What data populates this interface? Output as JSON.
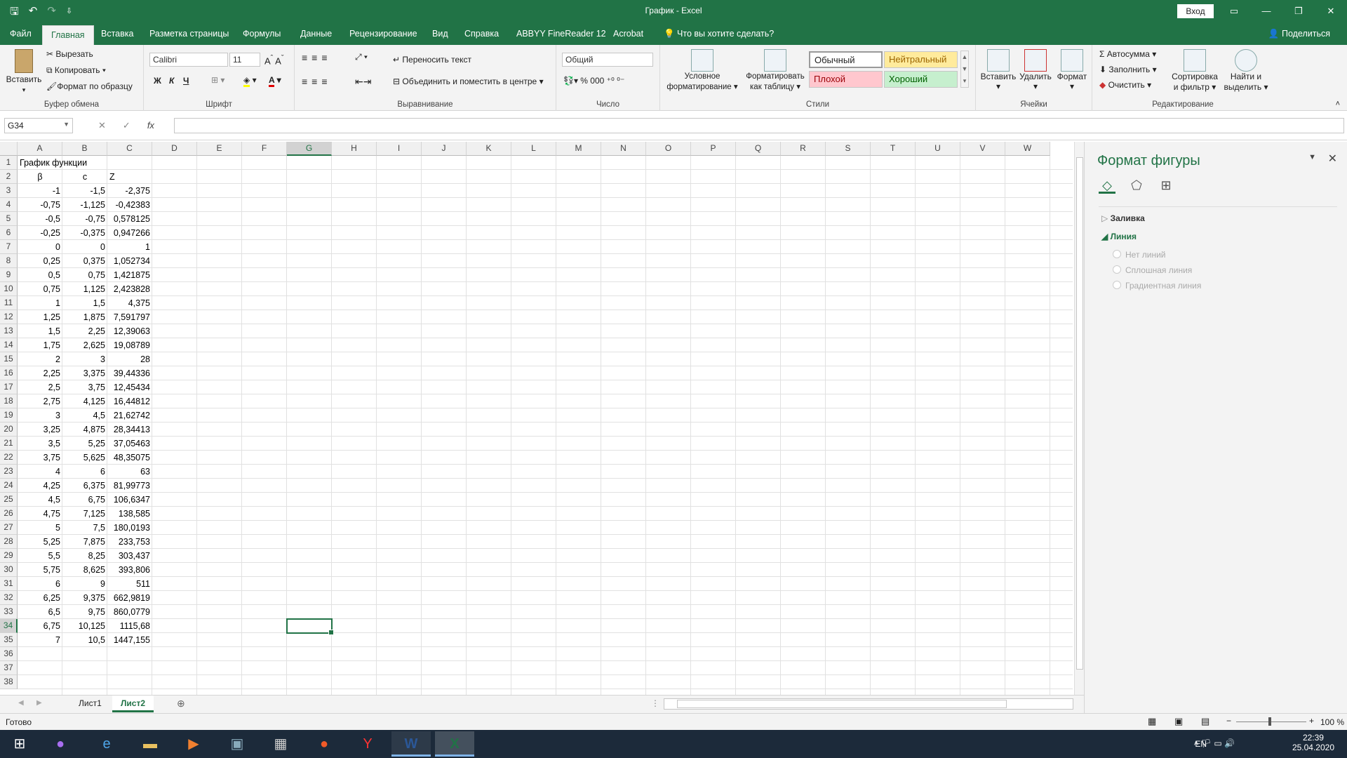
{
  "window": {
    "title": "График  -  Excel",
    "signin": "Вход"
  },
  "qat": {
    "save": "🖫",
    "undo": "↶",
    "redo": "↷",
    "more": "⇩"
  },
  "tabs": [
    "Файл",
    "Главная",
    "Вставка",
    "Разметка страницы",
    "Формулы",
    "Данные",
    "Рецензирование",
    "Вид",
    "Справка",
    "ABBYY FineReader 12",
    "Acrobat",
    "Что вы хотите сделать?"
  ],
  "share": "Поделиться",
  "ribbon": {
    "clipboard": {
      "paste": "Вставить",
      "cut": "Вырезать",
      "copy": "Копировать",
      "format_painter": "Формат по образцу",
      "label": "Буфер обмена"
    },
    "font": {
      "name": "Calibri",
      "size": "11",
      "bold": "Ж",
      "italic": "К",
      "underline": "Ч",
      "label": "Шрифт"
    },
    "align": {
      "wrap": "Переносить текст",
      "merge": "Объединить и поместить в центре",
      "label": "Выравнивание"
    },
    "number": {
      "format": "Общий",
      "label": "Число"
    },
    "styles": {
      "cond": "Условное",
      "cond2": "форматирование",
      "table": "Форматировать",
      "table2": "как таблицу",
      "normal": "Обычный",
      "neutral": "Нейтральный",
      "bad": "Плохой",
      "good": "Хороший",
      "label": "Стили"
    },
    "cells": {
      "insert": "Вставить",
      "delete": "Удалить",
      "format": "Формат",
      "label": "Ячейки"
    },
    "edit": {
      "autosum": "Автосумма",
      "fill": "Заполнить",
      "clear": "Очистить",
      "sort": "Сортировка",
      "sort2": "и фильтр",
      "find": "Найти и",
      "find2": "выделить",
      "label": "Редактирование"
    }
  },
  "formula_bar": {
    "name_box": "G34",
    "fx": "fx",
    "value": ""
  },
  "columns": [
    "A",
    "B",
    "C",
    "D",
    "E",
    "F",
    "G",
    "H",
    "I",
    "J",
    "K",
    "L",
    "M",
    "N",
    "O",
    "P",
    "Q",
    "R",
    "S",
    "T",
    "U",
    "V",
    "W"
  ],
  "rows": [
    "1",
    "2",
    "3",
    "4",
    "5",
    "6",
    "7",
    "8",
    "9",
    "10",
    "11",
    "12",
    "13",
    "14",
    "15",
    "16",
    "17",
    "18",
    "19",
    "20",
    "21",
    "22",
    "23",
    "24",
    "25",
    "26",
    "27",
    "28",
    "29",
    "30",
    "31",
    "32",
    "33",
    "34",
    "35",
    "36",
    "37",
    "38"
  ],
  "sheet": {
    "title": "График функции",
    "headers": [
      "β",
      "c",
      "Z"
    ],
    "data": [
      [
        "-1",
        "-1,5",
        "-2,375"
      ],
      [
        "-0,75",
        "-1,125",
        "-0,42383"
      ],
      [
        "-0,5",
        "-0,75",
        "0,578125"
      ],
      [
        "-0,25",
        "-0,375",
        "0,947266"
      ],
      [
        "0",
        "0",
        "1"
      ],
      [
        "0,25",
        "0,375",
        "1,052734"
      ],
      [
        "0,5",
        "0,75",
        "1,421875"
      ],
      [
        "0,75",
        "1,125",
        "2,423828"
      ],
      [
        "1",
        "1,5",
        "4,375"
      ],
      [
        "1,25",
        "1,875",
        "7,591797"
      ],
      [
        "1,5",
        "2,25",
        "12,39063"
      ],
      [
        "1,75",
        "2,625",
        "19,08789"
      ],
      [
        "2",
        "3",
        "28"
      ],
      [
        "2,25",
        "3,375",
        "39,44336"
      ],
      [
        "2,5",
        "3,75",
        "12,45434"
      ],
      [
        "2,75",
        "4,125",
        "16,44812"
      ],
      [
        "3",
        "4,5",
        "21,62742"
      ],
      [
        "3,25",
        "4,875",
        "28,34413"
      ],
      [
        "3,5",
        "5,25",
        "37,05463"
      ],
      [
        "3,75",
        "5,625",
        "48,35075"
      ],
      [
        "4",
        "6",
        "63"
      ],
      [
        "4,25",
        "6,375",
        "81,99773"
      ],
      [
        "4,5",
        "6,75",
        "106,6347"
      ],
      [
        "4,75",
        "7,125",
        "138,585"
      ],
      [
        "5",
        "7,5",
        "180,0193"
      ],
      [
        "5,25",
        "7,875",
        "233,753"
      ],
      [
        "5,5",
        "8,25",
        "303,437"
      ],
      [
        "5,75",
        "8,625",
        "393,806"
      ],
      [
        "6",
        "9",
        "511"
      ],
      [
        "6,25",
        "9,375",
        "662,9819"
      ],
      [
        "6,5",
        "9,75",
        "860,0779"
      ],
      [
        "6,75",
        "10,125",
        "1115,68"
      ],
      [
        "7",
        "10,5",
        "1447,155"
      ]
    ]
  },
  "sheets": [
    "Лист1",
    "Лист2"
  ],
  "status": {
    "ready": "Готово",
    "zoom": "100 %"
  },
  "pane": {
    "title": "Формат фигуры",
    "fill": "Заливка",
    "line": "Линия",
    "opt1": "Нет линий",
    "opt2": "Сплошная линия",
    "opt3": "Градиентная линия"
  },
  "tray": {
    "lang": "EN",
    "time": "22:39",
    "date": "25.04.2020"
  }
}
